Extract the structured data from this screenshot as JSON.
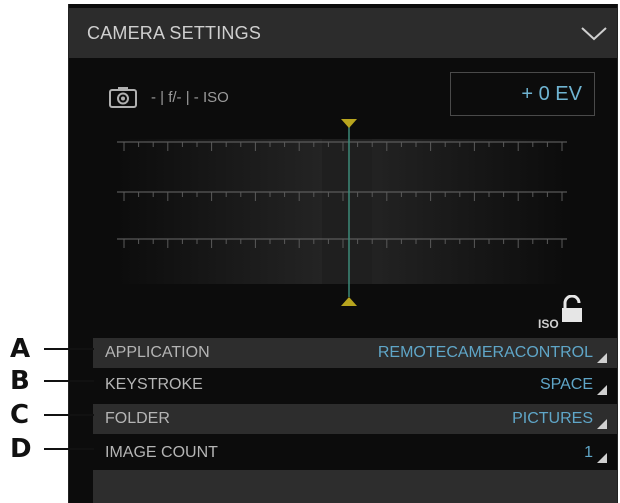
{
  "panel": {
    "title": "CAMERA SETTINGS",
    "readout": "- | f/- | - ISO",
    "exposure": "+ 0 EV",
    "iso_label": "ISO"
  },
  "settings": [
    {
      "label": "APPLICATION",
      "value": "REMOTECAMERACONTROL"
    },
    {
      "label": "KEYSTROKE",
      "value": "SPACE"
    },
    {
      "label": "FOLDER",
      "value": "PICTURES"
    },
    {
      "label": "IMAGE COUNT",
      "value": "1"
    }
  ],
  "annotations": [
    "A",
    "B",
    "C",
    "D"
  ],
  "colors": {
    "accent": "#5fa6c8",
    "marker": "#b8a51e",
    "indicator": "#3d8a78",
    "panel_bg": "#0c0c0c",
    "row_bg": "#2d2d2d"
  },
  "icons": {
    "camera": "camera-icon",
    "collapse": "chevron-down-icon",
    "lock": "lock-icon",
    "dropdown": "dropdown-triangle-icon"
  }
}
